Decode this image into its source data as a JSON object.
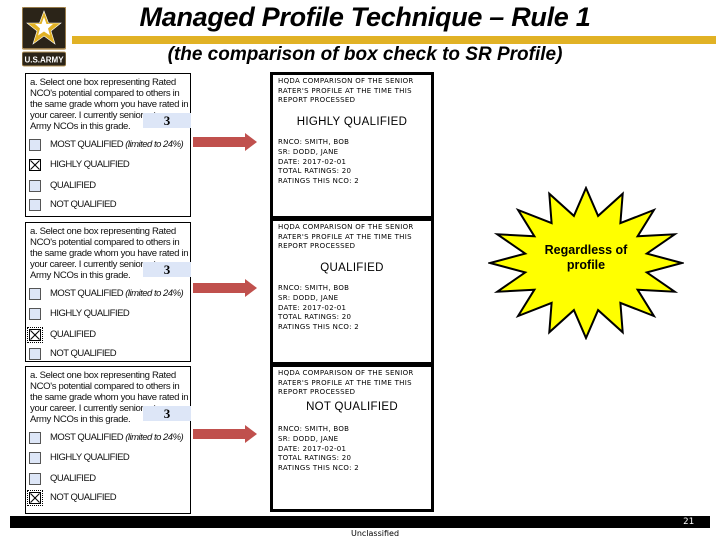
{
  "header": {
    "logo_text": "U.S.ARMY",
    "title": "Managed Profile Technique – Rule 1",
    "subtitle": "(the comparison of box check to SR Profile)",
    "accent_color": "#e1b225"
  },
  "examples": [
    {
      "form": {
        "prompt": "a. Select one box representing Rated NCO's potential compared to others in the same grade whom you have rated in your career.  I currently senior rate",
        "prompt_tail": "Army NCOs in this grade.",
        "senior_rate_count": "3",
        "options": [
          {
            "label": "MOST QUALIFIED",
            "note": "(limited to 24%)",
            "checked": false
          },
          {
            "label": "HIGHLY QUALIFIED",
            "note": "",
            "checked": true
          },
          {
            "label": "QUALIFIED",
            "note": "",
            "checked": false
          },
          {
            "label": "NOT QUALIFIED",
            "note": "",
            "checked": false
          }
        ]
      },
      "hqda": {
        "heading": "HQDA COMPARISON OF THE SENIOR RATER'S PROFILE AT THE TIME THIS REPORT PROCESSED",
        "verdict": "HIGHLY QUALIFIED",
        "rnco": "RNCO: SMITH, BOB",
        "sr": "SR:  DODD, JANE",
        "date": "DATE: 2017-02-01",
        "total_ratings": "TOTAL RATINGS: 20",
        "ratings_this_nco": "RATINGS THIS NCO: 2"
      }
    },
    {
      "form": {
        "prompt": "a. Select one box representing Rated NCO's potential compared to others in the same grade whom you have rated in your career.  I currently senior rate",
        "prompt_tail": "Army NCOs in this grade.",
        "senior_rate_count": "3",
        "options": [
          {
            "label": "MOST QUALIFIED",
            "note": "(limited to 24%)",
            "checked": false
          },
          {
            "label": "HIGHLY QUALIFIED",
            "note": "",
            "checked": false
          },
          {
            "label": "QUALIFIED",
            "note": "",
            "checked": true
          },
          {
            "label": "NOT QUALIFIED",
            "note": "",
            "checked": false
          }
        ]
      },
      "hqda": {
        "heading": "HQDA COMPARISON OF THE SENIOR RATER'S PROFILE AT THE TIME THIS REPORT PROCESSED",
        "verdict": "QUALIFIED",
        "rnco": "RNCO: SMITH, BOB",
        "sr": "SR:  DODD, JANE",
        "date": "DATE: 2017-02-01",
        "total_ratings": "TOTAL RATINGS: 20",
        "ratings_this_nco": "RATINGS THIS NCO: 2"
      }
    },
    {
      "form": {
        "prompt": "a. Select one box representing Rated NCO's potential compared to others in the same grade whom you have rated in your career.  I currently senior rate",
        "prompt_tail": "Army NCOs in this grade.",
        "senior_rate_count": "3",
        "options": [
          {
            "label": "MOST QUALIFIED",
            "note": "(limited to 24%)",
            "checked": false
          },
          {
            "label": "HIGHLY QUALIFIED",
            "note": "",
            "checked": false
          },
          {
            "label": "QUALIFIED",
            "note": "",
            "checked": false
          },
          {
            "label": "NOT QUALIFIED",
            "note": "",
            "checked": true
          }
        ]
      },
      "hqda": {
        "heading": "HQDA COMPARISON OF THE SENIOR RATER'S PROFILE AT THE TIME THIS REPORT PROCESSED",
        "verdict": "NOT QUALIFIED",
        "rnco": "RNCO: SMITH, BOB",
        "sr": "SR:  DODD, JANE",
        "date": "DATE: 2017-02-01",
        "total_ratings": "TOTAL RATINGS: 20",
        "ratings_this_nco": "RATINGS THIS NCO: 2"
      }
    }
  ],
  "callout": {
    "text_line1": "Regardless of",
    "text_line2": "profile",
    "fill_color": "#ffff00"
  },
  "arrow_color": "#c0504d",
  "footer": {
    "page_number": "21",
    "classification": "Unclassified"
  }
}
